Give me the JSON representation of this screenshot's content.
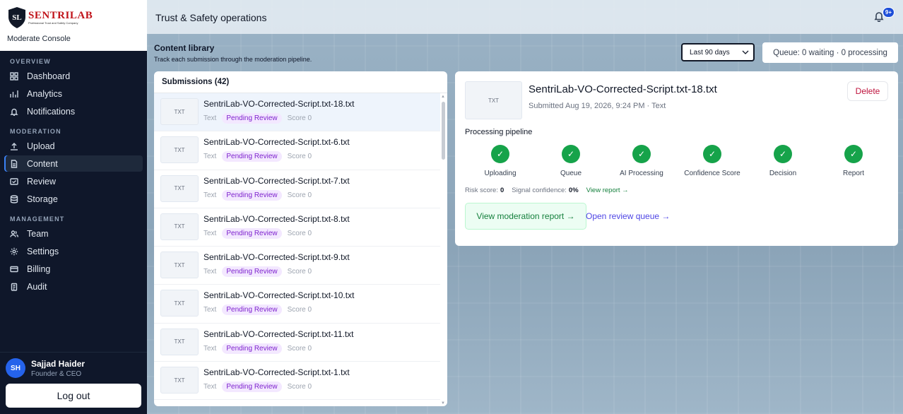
{
  "brand": {
    "logo_initials": "SL",
    "logo_word": "SENTRILAB",
    "logo_tagline": "Professional Trust and Safety Company",
    "subtitle": "Moderate Console"
  },
  "nav": {
    "sections": [
      {
        "title": "OVERVIEW",
        "items": [
          {
            "label": "Dashboard",
            "icon": "dashboard-icon"
          },
          {
            "label": "Analytics",
            "icon": "chart-icon"
          },
          {
            "label": "Notifications",
            "icon": "bell-icon"
          }
        ]
      },
      {
        "title": "MODERATION",
        "items": [
          {
            "label": "Upload",
            "icon": "upload-icon"
          },
          {
            "label": "Content",
            "icon": "document-icon",
            "active": true
          },
          {
            "label": "Review",
            "icon": "review-icon"
          },
          {
            "label": "Storage",
            "icon": "database-icon"
          }
        ]
      },
      {
        "title": "MANAGEMENT",
        "items": [
          {
            "label": "Team",
            "icon": "users-icon"
          },
          {
            "label": "Settings",
            "icon": "gear-icon"
          },
          {
            "label": "Billing",
            "icon": "card-icon"
          },
          {
            "label": "Audit",
            "icon": "clipboard-icon"
          }
        ]
      }
    ]
  },
  "user": {
    "initials": "SH",
    "name": "Sajjad Haider",
    "role": "Founder & CEO",
    "logout_label": "Log out"
  },
  "topbar": {
    "title": "Trust & Safety operations",
    "notification_badge": "9+"
  },
  "library": {
    "title": "Content library",
    "subtitle": "Track each submission through the moderation pipeline.",
    "range": "Last 90 days",
    "queue_status": "Queue: 0 waiting · 0 processing"
  },
  "submissions": {
    "header": "Submissions (42)",
    "items": [
      {
        "thumb": "TXT",
        "name": "SentriLab-VO-Corrected-Script.txt-18.txt",
        "type": "Text",
        "status": "Pending Review",
        "score": "Score 0",
        "selected": true
      },
      {
        "thumb": "TXT",
        "name": "SentriLab-VO-Corrected-Script.txt-6.txt",
        "type": "Text",
        "status": "Pending Review",
        "score": "Score 0"
      },
      {
        "thumb": "TXT",
        "name": "SentriLab-VO-Corrected-Script.txt-7.txt",
        "type": "Text",
        "status": "Pending Review",
        "score": "Score 0"
      },
      {
        "thumb": "TXT",
        "name": "SentriLab-VO-Corrected-Script.txt-8.txt",
        "type": "Text",
        "status": "Pending Review",
        "score": "Score 0"
      },
      {
        "thumb": "TXT",
        "name": "SentriLab-VO-Corrected-Script.txt-9.txt",
        "type": "Text",
        "status": "Pending Review",
        "score": "Score 0"
      },
      {
        "thumb": "TXT",
        "name": "SentriLab-VO-Corrected-Script.txt-10.txt",
        "type": "Text",
        "status": "Pending Review",
        "score": "Score 0"
      },
      {
        "thumb": "TXT",
        "name": "SentriLab-VO-Corrected-Script.txt-11.txt",
        "type": "Text",
        "status": "Pending Review",
        "score": "Score 0"
      },
      {
        "thumb": "TXT",
        "name": "SentriLab-VO-Corrected-Script.txt-1.txt",
        "type": "Text",
        "status": "Pending Review",
        "score": "Score 0"
      }
    ]
  },
  "detail": {
    "thumb": "TXT",
    "title": "SentriLab-VO-Corrected-Script.txt-18.txt",
    "submitted": "Submitted Aug 19, 2026, 9:24 PM · Text",
    "delete_label": "Delete",
    "pipeline_title": "Processing pipeline",
    "steps": [
      {
        "label": "Uploading",
        "mark": "✓"
      },
      {
        "label": "Queue",
        "mark": "✓"
      },
      {
        "label": "AI Processing",
        "mark": "✓"
      },
      {
        "label": "Confidence Score",
        "mark": "✓"
      },
      {
        "label": "Decision",
        "mark": "✓"
      },
      {
        "label": "Report",
        "mark": "✓"
      }
    ],
    "risk_label": "Risk score:",
    "risk_value": "0",
    "confidence_label": "Signal confidence:",
    "confidence_value": "0%",
    "view_report_link": "View report →",
    "report_button": "View moderation report →",
    "review_queue_link": "Open review queue →"
  },
  "colors": {
    "sidebar_bg": "#0f172a",
    "accent_blue": "#2563eb",
    "success_green": "#16a34a",
    "pending_purple": "#7e22ce",
    "delete_red": "#be123c"
  }
}
